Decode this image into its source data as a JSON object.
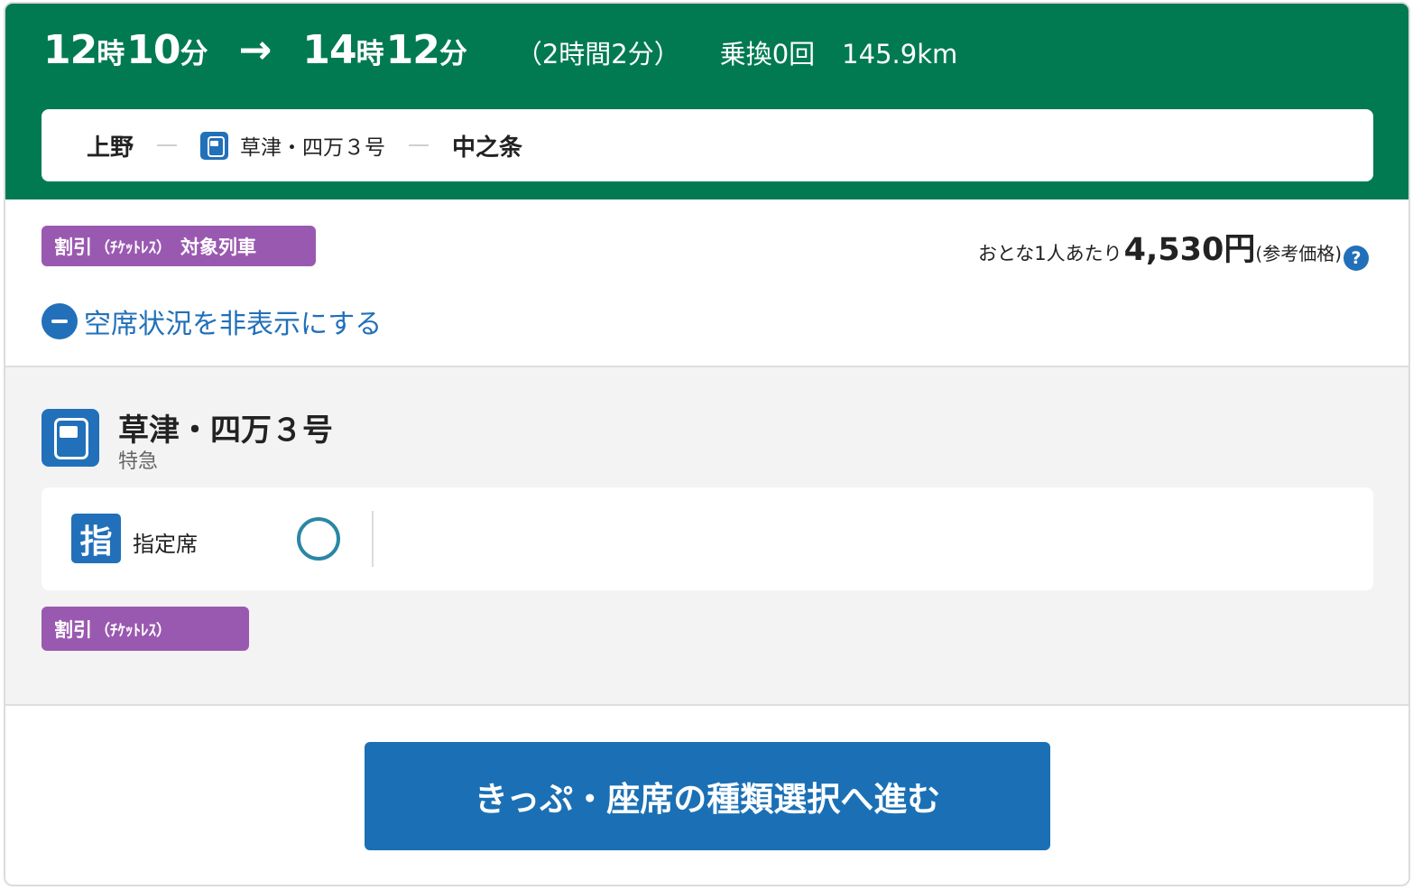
{
  "header": {
    "depart": {
      "hour": "12",
      "hour_unit": "時",
      "minute": "10",
      "minute_unit": "分"
    },
    "arrow": "→",
    "arrive": {
      "hour": "14",
      "hour_unit": "時",
      "minute": "12",
      "minute_unit": "分"
    },
    "duration": "（2時間2分）",
    "transfers": "乗換0回",
    "distance": "145.9km"
  },
  "route": {
    "from": "上野",
    "train": "草津・四万３号",
    "to": "中之条"
  },
  "discount_badge": {
    "label": "割引",
    "ticketless": "（ﾁｹｯﾄﾚｽ）",
    "target": "対象列車"
  },
  "price": {
    "label": "おとな1人あたり",
    "value": "4,530円",
    "note": "(参考価格)",
    "help": "?"
  },
  "availability_toggle": "空席状況を非表示にする",
  "train_detail": {
    "name": "草津・四万３号",
    "type": "特急",
    "seat_icon": "指",
    "seat_label": "指定席",
    "availability": "available-circle",
    "badge_label": "割引",
    "badge_ticketless": "（ﾁｹｯﾄﾚｽ）"
  },
  "proceed_button": "きっぷ・座席の種類選択へ進む",
  "colors": {
    "header_green": "#017a52",
    "accent_blue": "#2270b9",
    "badge_purple": "#9a59b0",
    "available_mark": "#2a87a5",
    "button_blue": "#1b70b5"
  }
}
